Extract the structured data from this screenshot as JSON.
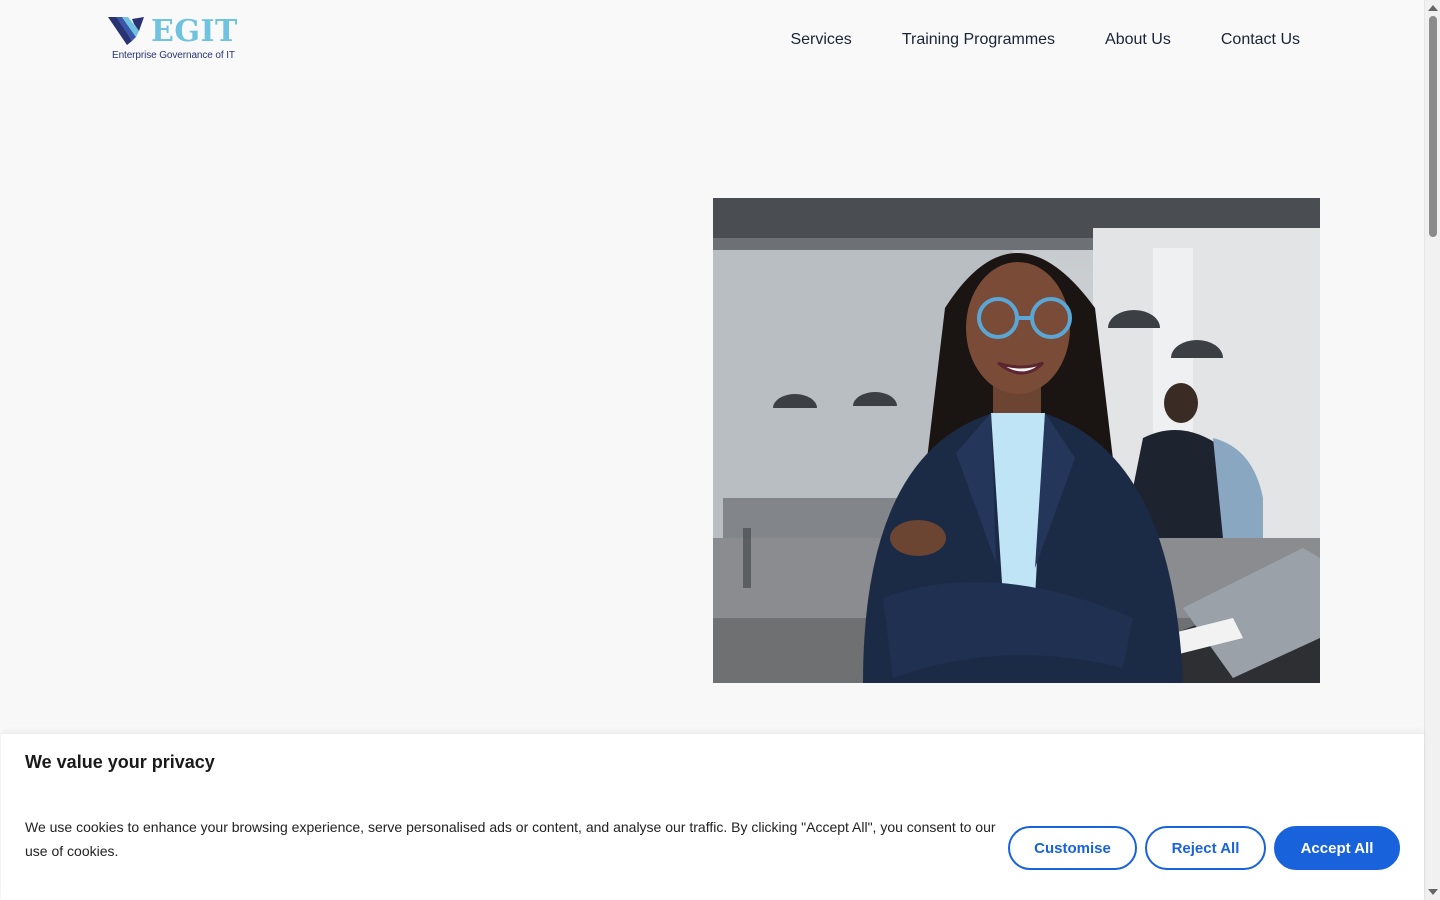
{
  "header": {
    "logo": {
      "name": "EGIT",
      "tagline": "Enterprise Governance of IT",
      "icon": "chevron-stripes-logo"
    },
    "nav": [
      {
        "label": "Services"
      },
      {
        "label": "Training Programmes"
      },
      {
        "label": "About Us"
      },
      {
        "label": "Contact Us"
      }
    ]
  },
  "hero": {
    "image": "professional-woman-smiling-arms-crossed-office-photo"
  },
  "cookie_banner": {
    "title": "We value your privacy",
    "text": "We use cookies to enhance your browsing experience, serve personalised ads or content, and analyse our traffic. By clicking \"Accept All\", you consent to our use of cookies.",
    "buttons": {
      "customise": "Customise",
      "reject": "Reject All",
      "accept": "Accept All"
    },
    "colors": {
      "accent": "#1863dc"
    }
  },
  "brand_colors": {
    "logo_light": "#6fc3e0",
    "logo_dark": "#2a3372"
  }
}
